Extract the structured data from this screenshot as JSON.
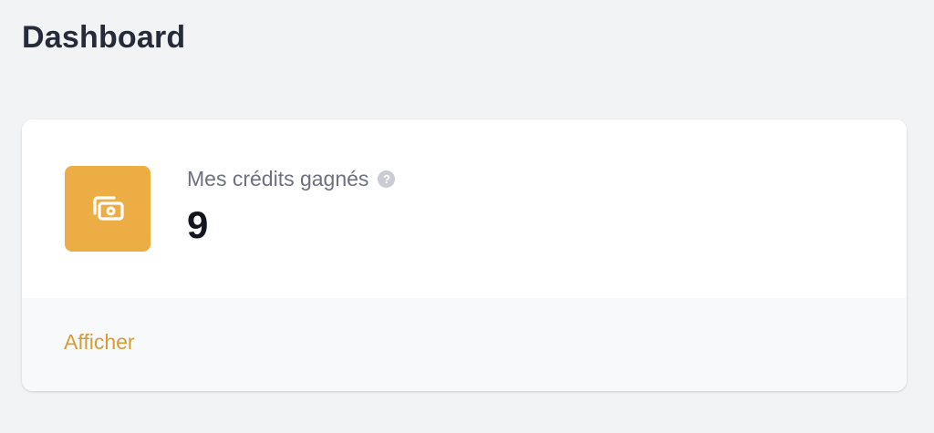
{
  "page": {
    "title": "Dashboard"
  },
  "stat_card": {
    "icon": "cash-icon",
    "label": "Mes crédits gagnés",
    "help_icon": "question-circle-icon",
    "value": "9",
    "footer_link": "Afficher"
  },
  "colors": {
    "background": "#f2f3f5",
    "accent": "#ecad45",
    "link": "#d59d35",
    "title": "#252b38"
  }
}
